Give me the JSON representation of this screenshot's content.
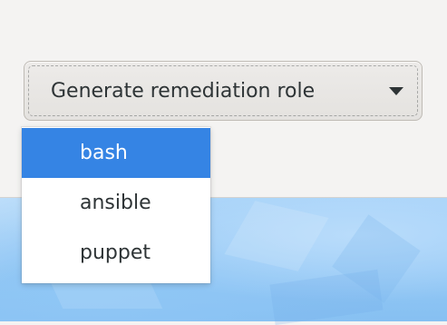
{
  "combo": {
    "label": "Generate remediation role",
    "arrow_icon": "pan-down-icon"
  },
  "menu": {
    "items": [
      {
        "label": "bash",
        "selected": true
      },
      {
        "label": "ansible",
        "selected": false
      },
      {
        "label": "puppet",
        "selected": false
      }
    ]
  },
  "colors": {
    "window_bg": "#f4f3f2",
    "selection": "#3584e4",
    "text": "#2e3436",
    "desktop": "#99cbf6"
  }
}
